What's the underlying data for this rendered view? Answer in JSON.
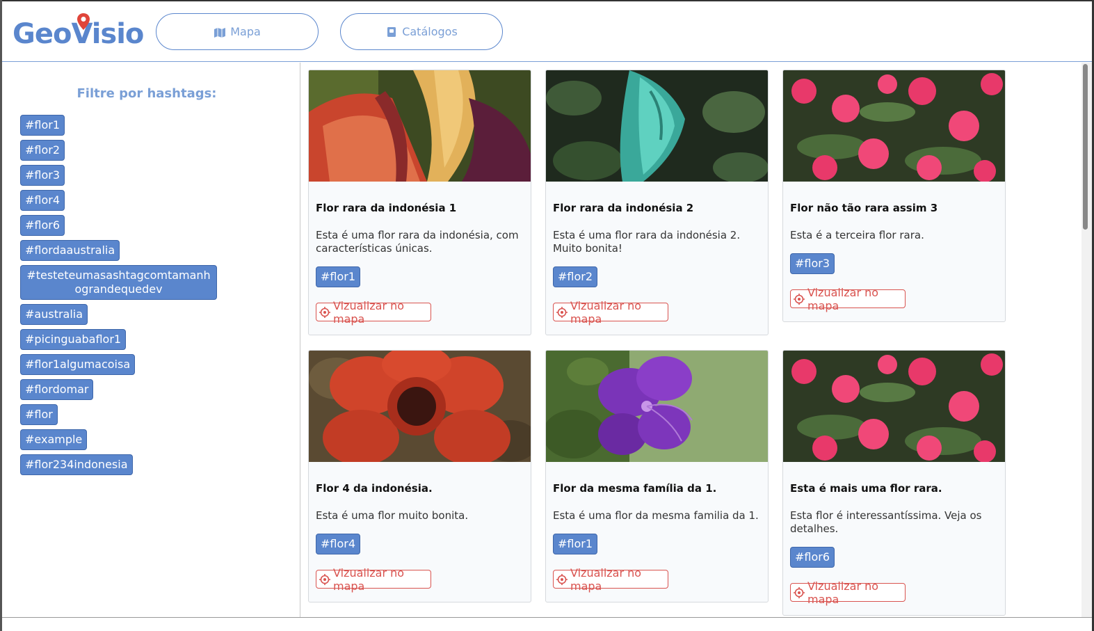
{
  "header": {
    "logo_text": "GeoVisio",
    "nav": [
      {
        "label": "Mapa",
        "icon": "map-icon"
      },
      {
        "label": "Catálogos",
        "icon": "book-icon"
      }
    ]
  },
  "sidebar": {
    "title": "Filtre por hashtags:",
    "tags": [
      "#flor1",
      "#flor2",
      "#flor3",
      "#flor4",
      "#flor6",
      "#flordaaustralia",
      "#testeteumasashtagcomtamanhograndequedev",
      "#australia",
      "#picinguabaflor1",
      "#flor1algumacoisa",
      "#flordomar",
      "#flor",
      "#example",
      "#flor234indonesia"
    ]
  },
  "cards": [
    {
      "title": "Flor rara da indonésia 1",
      "description": "Esta é uma flor rara da indonésia, com características únicas.",
      "tag": "#flor1",
      "map_label": "Vizualizar no mapa",
      "image": "corpse-flower-photo"
    },
    {
      "title": "Flor rara da indonésia 2",
      "description": "Esta é uma flor rara da indonésia 2. Muito bonita!",
      "tag": "#flor2",
      "map_label": "Vizualizar no mapa",
      "image": "jade-vine-photo"
    },
    {
      "title": "Flor não tão rara assim 3",
      "description": "Esta é a terceira flor rara.",
      "tag": "#flor3",
      "map_label": "Vizualizar no mapa",
      "image": "crown-of-thorns-photo"
    },
    {
      "title": "Flor 4 da indonésia.",
      "description": "Esta é uma flor muito bonita.",
      "tag": "#flor4",
      "map_label": "Vizualizar no mapa",
      "image": "rafflesia-photo"
    },
    {
      "title": "Flor da mesma família da 1.",
      "description": "Esta é uma flor da mesma familia da 1.",
      "tag": "#flor1",
      "map_label": "Vizualizar no mapa",
      "image": "purple-tibouchina-photo"
    },
    {
      "title": "Esta é mais uma flor rara.",
      "description": "Esta flor é interessantíssima. Veja os detalhes.",
      "tag": "#flor6",
      "map_label": "Vizualizar no mapa",
      "image": "crown-of-thorns-photo"
    }
  ],
  "colors": {
    "accent": "#5a86cd",
    "accent_light": "#7a9fd6",
    "danger": "#d9534f"
  }
}
